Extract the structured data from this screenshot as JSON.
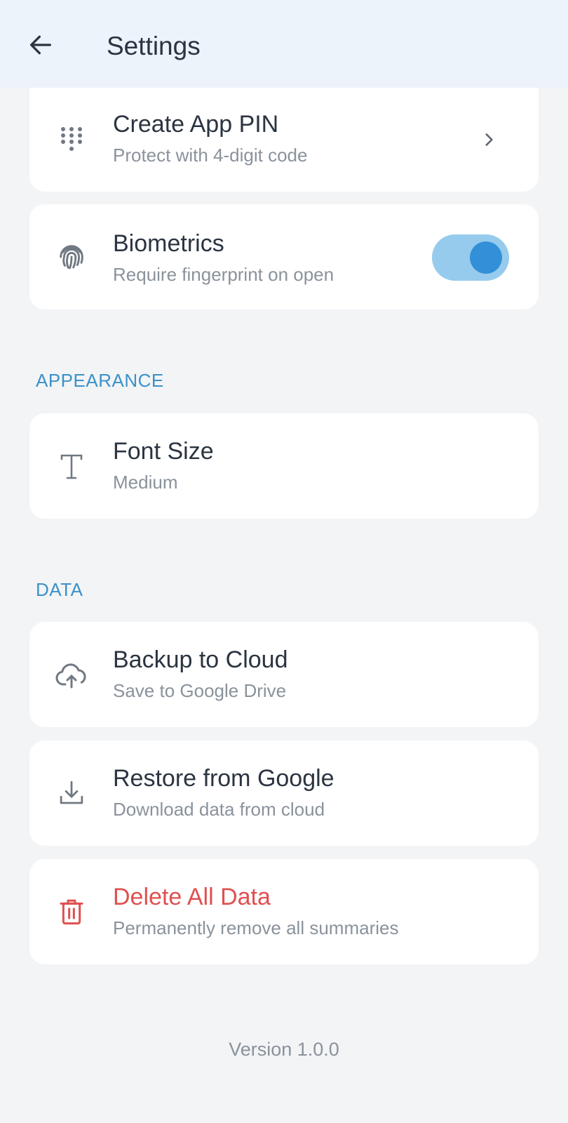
{
  "app_bar": {
    "title": "Settings",
    "back_icon": "arrow-left-icon"
  },
  "security": {
    "pin": {
      "icon": "dialpad-icon",
      "title": "Create App PIN",
      "subtitle": "Protect with 4-digit code",
      "trailing_icon": "chevron-right-icon"
    },
    "biometrics": {
      "icon": "fingerprint-icon",
      "title": "Biometrics",
      "subtitle": "Require fingerprint on open",
      "enabled": true
    }
  },
  "appearance": {
    "header": "APPEARANCE",
    "font_size": {
      "icon": "text-t-icon",
      "title": "Font Size",
      "value": "Medium"
    }
  },
  "data": {
    "header": "DATA",
    "backup": {
      "icon": "cloud-upload-icon",
      "title": "Backup to Cloud",
      "subtitle": "Save to Google Drive"
    },
    "restore": {
      "icon": "download-icon",
      "title": "Restore from Google",
      "subtitle": "Download data from cloud"
    },
    "delete": {
      "icon": "trash-icon",
      "title": "Delete All Data",
      "subtitle": "Permanently remove all summaries"
    }
  },
  "footer": {
    "version": "Version 1.0.0"
  },
  "colors": {
    "accent": "#3A92C8",
    "toggle_track": "#96CBEE",
    "toggle_knob": "#3390D8",
    "danger": "#E05050",
    "app_bar_bg": "#EDF3FB",
    "page_bg": "#F3F4F6"
  }
}
